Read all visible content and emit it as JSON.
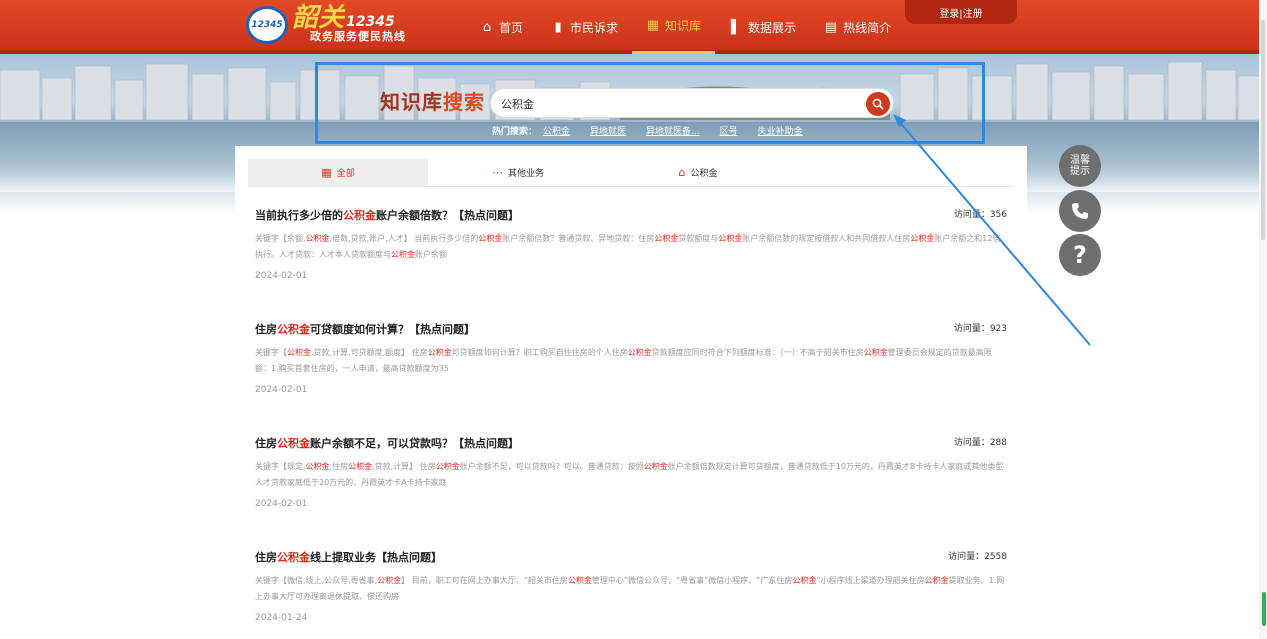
{
  "header": {
    "logo": {
      "badge": "12345",
      "brand_char": "韶关",
      "brand_num": "12345",
      "subtitle": "政务服务便民热线"
    },
    "nav": [
      {
        "label": "首页",
        "icon": "home-icon"
      },
      {
        "label": "市民诉求",
        "icon": "chat-icon"
      },
      {
        "label": "知识库",
        "icon": "book-icon",
        "active": true
      },
      {
        "label": "数据展示",
        "icon": "bar-chart-icon"
      },
      {
        "label": "热线简介",
        "icon": "document-icon"
      }
    ],
    "login": "登录|注册"
  },
  "search": {
    "title_part1": "知识库",
    "title_part2": "搜索",
    "value": "公积金",
    "hot_label": "热门搜索：",
    "hot_items": [
      "公积金",
      "异地就医",
      "异地就医备...",
      "区号",
      "失业补助金"
    ]
  },
  "tabs": [
    {
      "label": "全部",
      "icon": "grid-icon",
      "active": true
    },
    {
      "label": "其他业务",
      "icon": "more-icon"
    },
    {
      "label": "公积金",
      "icon": "house-icon"
    }
  ],
  "results": [
    {
      "title": [
        {
          "t": "当前执行多少倍的"
        },
        {
          "t": "公积金",
          "kw": true
        },
        {
          "t": "账户余额倍数？【热点问题】"
        }
      ],
      "visits": "访问量：356",
      "desc": [
        {
          "t": "关键字【余额,"
        },
        {
          "t": "公积金",
          "kw": true
        },
        {
          "t": ",倍数,贷款,账户,人才】 当前执行多少倍的"
        },
        {
          "t": "公积金",
          "kw": true
        },
        {
          "t": "账户余额倍数？普通贷款、异地贷款：住房"
        },
        {
          "t": "公积金",
          "kw": true
        },
        {
          "t": "贷款额度与"
        },
        {
          "t": "公积金",
          "kw": true
        },
        {
          "t": "账户余额倍数的规定按借款人和共同借款人住房"
        },
        {
          "t": "公积金",
          "kw": true
        },
        {
          "t": "账户余额之和12倍执行。人才贷款：人才本人贷款额度与"
        },
        {
          "t": "公积金",
          "kw": true
        },
        {
          "t": "账户余额"
        }
      ],
      "date": "2024-02-01"
    },
    {
      "title": [
        {
          "t": "住房"
        },
        {
          "t": "公积金",
          "kw": true
        },
        {
          "t": "可贷额度如何计算？【热点问题】"
        }
      ],
      "visits": "访问量：923",
      "desc": [
        {
          "t": "关键字【"
        },
        {
          "t": "公积金",
          "kw": true
        },
        {
          "t": ",贷款,计算,可贷额度,额度】 住房"
        },
        {
          "t": "公积金",
          "kw": true
        },
        {
          "t": "可贷额度如何计算？职工购买自住住房的个人住房"
        },
        {
          "t": "公积金",
          "kw": true
        },
        {
          "t": "贷款额度应同时符合下列额度标准：（一）不高于韶关市住房"
        },
        {
          "t": "公积金",
          "kw": true
        },
        {
          "t": "管理委员会规定的贷款最高限额：1.购买首套住房的，一人申请，最高贷款额度为35"
        }
      ],
      "date": "2024-02-01"
    },
    {
      "title": [
        {
          "t": "住房"
        },
        {
          "t": "公积金",
          "kw": true
        },
        {
          "t": "账户余额不足，可以贷款吗？【热点问题】"
        }
      ],
      "visits": "访问量：288",
      "desc": [
        {
          "t": "关键字【规定,"
        },
        {
          "t": "公积金",
          "kw": true
        },
        {
          "t": ",住房"
        },
        {
          "t": "公积金",
          "kw": true
        },
        {
          "t": ",贷款,计算】 住房"
        },
        {
          "t": "公积金",
          "kw": true
        },
        {
          "t": "账户余额不足，可以贷款吗？可以。普通贷款：按照"
        },
        {
          "t": "公积金",
          "kw": true
        },
        {
          "t": "账户余额倍数规定计算可贷额度，普通贷款低于10万元的，丹霞英才B卡持卡人家庭或其他类型人才贷款家庭低于20万元的，丹霞英才卡A卡持卡家庭"
        }
      ],
      "date": "2024-02-01"
    },
    {
      "title": [
        {
          "t": "住房"
        },
        {
          "t": "公积金",
          "kw": true
        },
        {
          "t": "线上提取业务【热点问题】"
        }
      ],
      "visits": "访问量：2558",
      "desc": [
        {
          "t": "关键字【微信,线上,公众号,粤省事,"
        },
        {
          "t": "公积金",
          "kw": true
        },
        {
          "t": "】 目前，职工可在网上办事大厅、“韶关市住房"
        },
        {
          "t": "公积金",
          "kw": true
        },
        {
          "t": "管理中心”微信公众号、“粤省事”微信小程序、“广东住房"
        },
        {
          "t": "公积金",
          "kw": true
        },
        {
          "t": "”小程序线上渠道办理韶关住房"
        },
        {
          "t": "公积金",
          "kw": true
        },
        {
          "t": "提取业务。1.网上办事大厅可办理离退休提取、偿还购房"
        }
      ],
      "date": "2024-01-24"
    }
  ],
  "floating": {
    "tip_line1": "温馨",
    "tip_line2": "提示"
  }
}
